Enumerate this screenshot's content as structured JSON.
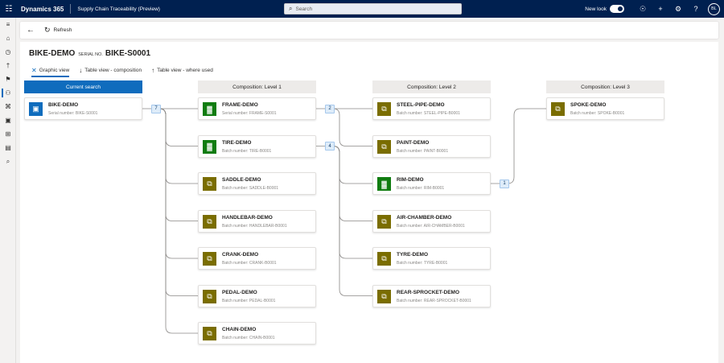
{
  "topbar": {
    "brand": "Dynamics 365",
    "app_title": "Supply Chain Traceability (Preview)",
    "search_placeholder": "Search",
    "new_look_label": "New look",
    "avatar_initials": "BL"
  },
  "commandbar": {
    "refresh_label": "Refresh"
  },
  "header": {
    "item": "BIKE-DEMO",
    "serial_label": "SERIAL NO.",
    "serial_number": "BIKE-S0001"
  },
  "tabs": [
    {
      "label": "Graphic view",
      "icon": "graph-icon"
    },
    {
      "label": "Table view - composition",
      "icon": "arrow-down-icon"
    },
    {
      "label": "Table view - where used",
      "icon": "arrow-up-icon"
    }
  ],
  "columns": [
    "Current search",
    "Composition: Level 1",
    "Composition: Level 2",
    "Composition: Level 3"
  ],
  "nodes": {
    "current": {
      "name": "BIKE-DEMO",
      "sub": "Serial number: BIKE-S0001",
      "icon": "cube-icon",
      "color": "#0f6cbd"
    },
    "level1": [
      {
        "name": "FRAME-DEMO",
        "sub": "Serial number: FRAME-S0001",
        "icon": "factory-icon",
        "color": "#107c10"
      },
      {
        "name": "TIRE-DEMO",
        "sub": "Batch number: TIRE-B0001",
        "icon": "factory-icon",
        "color": "#107c10"
      },
      {
        "name": "SADDLE-DEMO",
        "sub": "Batch number: SADDLE-B0001",
        "icon": "link-icon",
        "color": "#7a6d00"
      },
      {
        "name": "HANDLEBAR-DEMO",
        "sub": "Batch number: HANDLEBAR-B0001",
        "icon": "link-icon",
        "color": "#7a6d00"
      },
      {
        "name": "CRANK-DEMO",
        "sub": "Batch number: CRANK-B0001",
        "icon": "link-icon",
        "color": "#7a6d00"
      },
      {
        "name": "PEDAL-DEMO",
        "sub": "Batch number: PEDAL-B0001",
        "icon": "link-icon",
        "color": "#7a6d00"
      },
      {
        "name": "CHAIN-DEMO",
        "sub": "Batch number: CHAIN-B0001",
        "icon": "link-icon",
        "color": "#7a6d00"
      }
    ],
    "level2": [
      {
        "name": "STEEL-PIPE-DEMO",
        "sub": "Batch number: STEEL-PIPE-B0001",
        "icon": "link-icon",
        "color": "#7a6d00"
      },
      {
        "name": "PAINT-DEMO",
        "sub": "Batch number: PAINT-B0001",
        "icon": "link-icon",
        "color": "#7a6d00"
      },
      {
        "name": "RIM-DEMO",
        "sub": "Batch number: RIM-B0001",
        "icon": "factory-icon",
        "color": "#107c10"
      },
      {
        "name": "AIR-CHAMBER-DEMO",
        "sub": "Batch number: AIR-CHAMBER-B0001",
        "icon": "link-icon",
        "color": "#7a6d00"
      },
      {
        "name": "TYRE-DEMO",
        "sub": "Batch number: TYRE-B0001",
        "icon": "link-icon",
        "color": "#7a6d00"
      },
      {
        "name": "REAR-SPROCKET-DEMO",
        "sub": "Batch number: REAR-SPROCKET-B0001",
        "icon": "link-icon",
        "color": "#7a6d00"
      }
    ],
    "level3": [
      {
        "name": "SPOKE-DEMO",
        "sub": "Batch number: SPOKE-B0001",
        "icon": "link-icon",
        "color": "#7a6d00"
      }
    ]
  },
  "badges": {
    "bike_children": "7",
    "frame_children": "2",
    "tire_children": "4",
    "rim_children": "1"
  }
}
